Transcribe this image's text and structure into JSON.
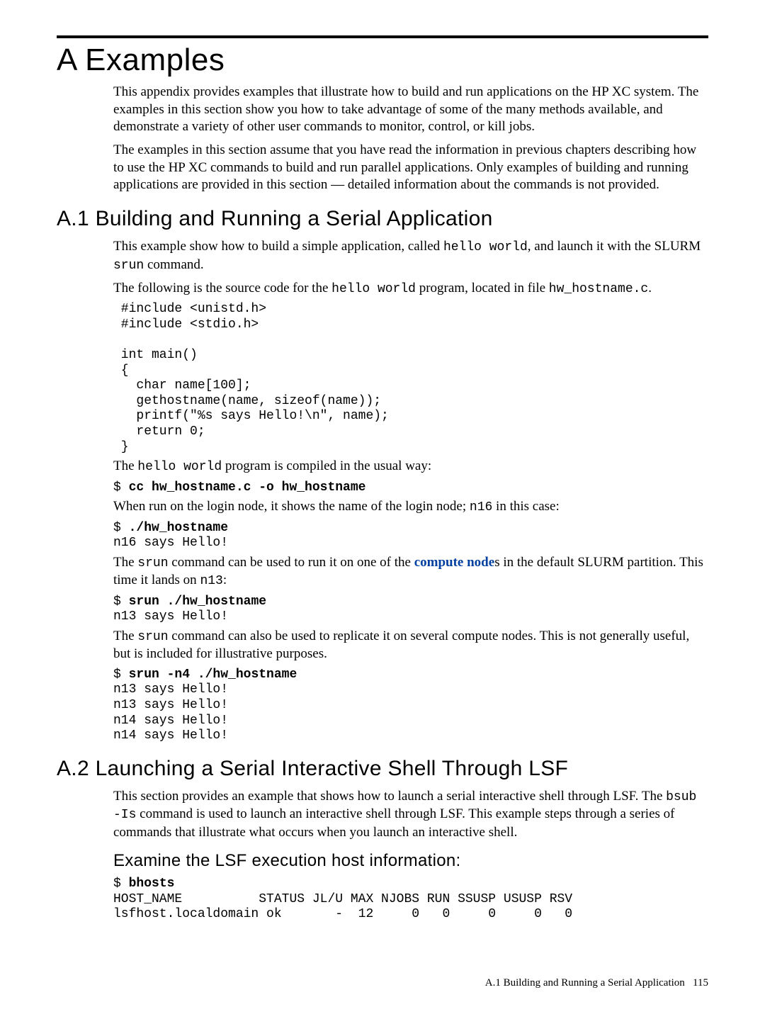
{
  "title": "A Examples",
  "intro": {
    "p1": "This appendix provides examples that illustrate how to build and run applications on the HP XC system. The examples in this section show you how to take advantage of some of the many methods available, and demonstrate a variety of other user commands to monitor, control, or kill jobs.",
    "p2": "The examples in this section assume that you have read the information in previous chapters describing how to use the HP XC commands to build and run parallel applications. Only examples of building and running applications are provided in this section — detailed information about the commands is not provided."
  },
  "sectionA1": {
    "heading": "A.1 Building and Running a Serial Application",
    "p1_pre": "This example show how to build a simple application, called ",
    "p1_code": "hello world",
    "p1_post": ", and launch it with the SLURM ",
    "p1_code2": "srun",
    "p1_post2": " command.",
    "p2_pre": "The following is the source code for the ",
    "p2_code": "hello world",
    "p2_mid": " program, located in file ",
    "p2_code2": "hw_hostname.c",
    "p2_post": ".",
    "codeblock1": " #include <unistd.h>\n #include <stdio.h>\n\n int main()\n {\n   char name[100];\n   gethostname(name, sizeof(name));\n   printf(\"%s says Hello!\\n\", name);\n   return 0;\n }",
    "p3_pre": "The ",
    "p3_code": "hello world",
    "p3_post": " program is compiled in the usual way:",
    "code2_prompt": "$ ",
    "code2_cmd": "cc hw_hostname.c -o hw_hostname",
    "p4_pre": "When run on the login node, it shows the name of the login node; ",
    "p4_code": "n16",
    "p4_post": " in this case:",
    "code3_prompt": "$ ",
    "code3_cmd": "./hw_hostname",
    "code3_out": "n16 says Hello!",
    "p5_pre": "The ",
    "p5_code": "srun",
    "p5_mid": " command can be used to run it on one of the ",
    "p5_link": "compute node",
    "p5_mid2": "s in the default SLURM partition. This time it lands on ",
    "p5_code2": "n13",
    "p5_post": ":",
    "code4_prompt": "$ ",
    "code4_cmd": "srun ./hw_hostname",
    "code4_out": "n13 says Hello!",
    "p6_pre": "The ",
    "p6_code": "srun",
    "p6_post": " command can also be used to replicate it on several compute nodes. This is not generally useful, but is included for illustrative purposes.",
    "code5_prompt": "$ ",
    "code5_cmd": "srun -n4 ./hw_hostname",
    "code5_out": "n13 says Hello!\nn13 says Hello!\nn14 says Hello!\nn14 says Hello!"
  },
  "sectionA2": {
    "heading": "A.2 Launching a Serial Interactive Shell Through LSF",
    "p1_pre": "This section provides an example that shows how to launch a serial interactive shell through LSF. The ",
    "p1_code": "bsub -Is",
    "p1_post": " command is used to launch an interactive shell through LSF. This example steps through a series of commands that illustrate what occurs when you launch an interactive shell.",
    "subheading": "Examine the LSF execution host information:",
    "code1_prompt": "$ ",
    "code1_cmd": "bhosts",
    "code1_out": "HOST_NAME          STATUS JL/U MAX NJOBS RUN SSUSP USUSP RSV\nlsfhost.localdomain ok       -  12     0   0     0     0   0"
  },
  "footer": {
    "text": "A.1 Building and Running a Serial Application",
    "page": "115"
  }
}
